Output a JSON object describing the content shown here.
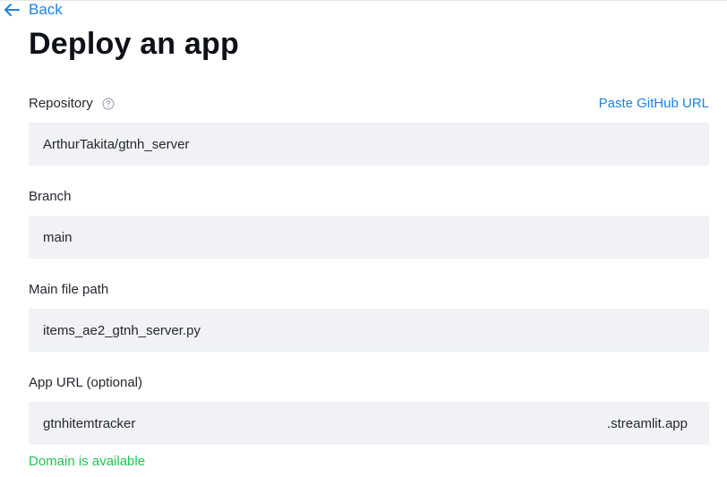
{
  "nav": {
    "back_label": "Back"
  },
  "page": {
    "title": "Deploy an app"
  },
  "repository": {
    "label": "Repository",
    "paste_link": "Paste GitHub URL",
    "value": "ArthurTakita/gtnh_server"
  },
  "branch": {
    "label": "Branch",
    "value": "main"
  },
  "main_file": {
    "label": "Main file path",
    "value": "items_ae2_gtnh_server.py"
  },
  "app_url": {
    "label": "App URL (optional)",
    "value": "gtnhitemtracker",
    "suffix": ".streamlit.app",
    "status": "Domain is available"
  },
  "colors": {
    "accent": "#1c83e1",
    "field_bg": "#f0f2f6",
    "success": "#21c354"
  },
  "icons": {
    "back": "arrow-left-icon",
    "help": "question-circle-icon"
  }
}
